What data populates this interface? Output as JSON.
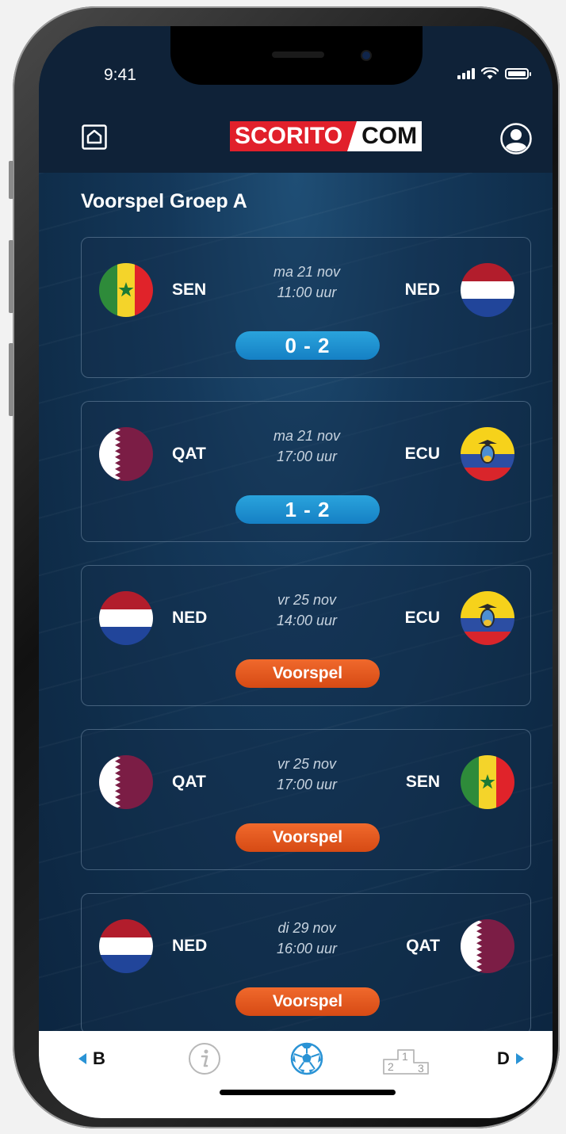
{
  "status_bar": {
    "time": "9:41"
  },
  "header": {
    "logo_left": "SCORITO",
    "logo_right": "COM"
  },
  "page": {
    "title": "Voorspel Groep A"
  },
  "matches": [
    {
      "home_code": "SEN",
      "home_flag": "senegal-flag",
      "away_code": "NED",
      "away_flag": "netherlands-flag",
      "day": "ma 21 nov",
      "time": "11:00 uur",
      "action": "0 - 2",
      "action_type": "score"
    },
    {
      "home_code": "QAT",
      "home_flag": "qatar-flag",
      "away_code": "ECU",
      "away_flag": "ecuador-flag",
      "day": "ma 21 nov",
      "time": "17:00 uur",
      "action": "1 - 2",
      "action_type": "score"
    },
    {
      "home_code": "NED",
      "home_flag": "netherlands-flag",
      "away_code": "ECU",
      "away_flag": "ecuador-flag",
      "day": "vr 25 nov",
      "time": "14:00 uur",
      "action": "Voorspel",
      "action_type": "predict"
    },
    {
      "home_code": "QAT",
      "home_flag": "qatar-flag",
      "away_code": "SEN",
      "away_flag": "senegal-flag",
      "day": "vr 25 nov",
      "time": "17:00 uur",
      "action": "Voorspel",
      "action_type": "predict"
    },
    {
      "home_code": "NED",
      "home_flag": "netherlands-flag",
      "away_code": "QAT",
      "away_flag": "qatar-flag",
      "day": "di 29 nov",
      "time": "16:00 uur",
      "action": "Voorspel",
      "action_type": "predict"
    }
  ],
  "tabbar": {
    "prev_label": "B",
    "next_label": "D",
    "podium_labels": [
      "1",
      "2",
      "3"
    ]
  },
  "colors": {
    "score_pill": "#1f91d0",
    "predict_pill": "#e55a1f",
    "accent_arrow": "#2a93d5",
    "logo_red": "#e1202b"
  }
}
